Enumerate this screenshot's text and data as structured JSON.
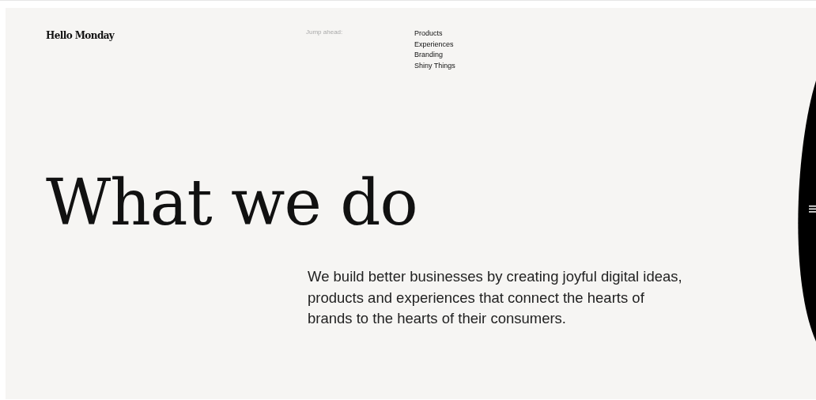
{
  "header": {
    "logo": "Hello Monday",
    "jump_label": "Jump ahead:",
    "links": [
      "Products",
      "Experiences",
      "Branding",
      "Shiny Things"
    ]
  },
  "hero": {
    "title": "What we do",
    "intro": "We build better businesses by creating joyful digital ideas, products and experiences that connect the hearts of brands to the hearts of their consumers."
  }
}
